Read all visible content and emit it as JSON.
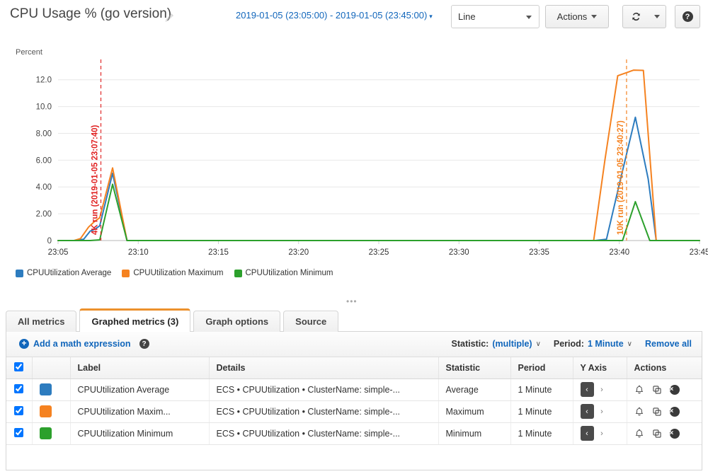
{
  "header": {
    "title": "CPU Usage % (go version)",
    "edit_icon": "pencil-icon",
    "time_range": "2019-01-05 (23:05:00) - 2019-01-05 (23:45:00)",
    "range_caret": "▾",
    "graph_type": "Line",
    "actions_label": "Actions",
    "refresh_icon": "refresh-icon",
    "help_icon": "help-icon",
    "help_glyph": "?"
  },
  "chart_data": {
    "type": "line",
    "title": "CPU Usage % (go version)",
    "ylabel": "Percent",
    "xlabel": "",
    "ylim": [
      0,
      13.2
    ],
    "yticks": [
      "0",
      "2.00",
      "4.00",
      "6.00",
      "8.00",
      "10.0",
      "12.0"
    ],
    "ytick_values": [
      0,
      2,
      4,
      6,
      8,
      10,
      12
    ],
    "xticks": [
      "23:05",
      "23:10",
      "23:15",
      "23:20",
      "23:25",
      "23:30",
      "23:35",
      "23:40",
      "23:45"
    ],
    "xtick_minutes": [
      0,
      5,
      10,
      15,
      20,
      25,
      30,
      35,
      40
    ],
    "grid": true,
    "legend_position": "bottom-left",
    "x_unit": "minutes from 23:05",
    "series": [
      {
        "name": "CPUUtilization Average",
        "color": "#2d7cbf",
        "points": [
          [
            0,
            0
          ],
          [
            1.0,
            0
          ],
          [
            1.6,
            0.1
          ],
          [
            2.0,
            0.7
          ],
          [
            2.3,
            0.85
          ],
          [
            2.6,
            1.1
          ],
          [
            3.4,
            5.02
          ],
          [
            4.3,
            0
          ],
          [
            5.0,
            0
          ],
          [
            33.5,
            0
          ],
          [
            34.2,
            0.1
          ],
          [
            35.0,
            4.2
          ],
          [
            36.0,
            9.2
          ],
          [
            36.8,
            4.6
          ],
          [
            37.3,
            0
          ],
          [
            40,
            0
          ]
        ]
      },
      {
        "name": "CPUUtilization Maximum",
        "color": "#f58220",
        "points": [
          [
            0,
            0
          ],
          [
            1.0,
            0
          ],
          [
            1.4,
            0.15
          ],
          [
            1.9,
            1.0
          ],
          [
            2.3,
            1.45
          ],
          [
            2.6,
            1.7
          ],
          [
            3.4,
            5.42
          ],
          [
            4.3,
            0
          ],
          [
            5.0,
            0
          ],
          [
            33.4,
            0
          ],
          [
            34.1,
            6.0
          ],
          [
            34.9,
            12.3
          ],
          [
            35.9,
            12.72
          ],
          [
            36.5,
            12.7
          ],
          [
            37.3,
            0
          ],
          [
            40,
            0
          ]
        ]
      },
      {
        "name": "CPUUtilization Minimum",
        "color": "#2ca02c",
        "points": [
          [
            0,
            0
          ],
          [
            2.0,
            0
          ],
          [
            2.6,
            0.05
          ],
          [
            3.4,
            4.2
          ],
          [
            4.3,
            0
          ],
          [
            5.0,
            0
          ],
          [
            35.2,
            0
          ],
          [
            36.0,
            2.9
          ],
          [
            36.9,
            0
          ],
          [
            40,
            0
          ]
        ]
      }
    ],
    "annotations": [
      {
        "label": "4K run (2019-01-05 23:07:40)",
        "x_minutes": 2.67,
        "color": "#e02020",
        "style": "dashed-vertical"
      },
      {
        "label": "10K run (2019-01-05 23:40:27)",
        "x_minutes": 35.45,
        "color": "#f58220",
        "style": "dashed-vertical"
      }
    ],
    "legend": [
      {
        "label": "CPUUtilization Average",
        "color": "#2d7cbf"
      },
      {
        "label": "CPUUtilization Maximum",
        "color": "#f58220"
      },
      {
        "label": "CPUUtilization Minimum",
        "color": "#2ca02c"
      }
    ]
  },
  "drag_handle": "•••",
  "tabs": [
    {
      "label": "All metrics",
      "active": false
    },
    {
      "label": "Graphed metrics (3)",
      "active": true
    },
    {
      "label": "Graph options",
      "active": false
    },
    {
      "label": "Source",
      "active": false
    }
  ],
  "toolbar": {
    "add_math_expression": "Add a math expression",
    "plus_glyph": "+",
    "help_glyph": "?",
    "statistic_label": "Statistic:",
    "statistic_value": "(multiple)",
    "period_label": "Period:",
    "period_value": "1 Minute",
    "chevron": "∨",
    "remove_all": "Remove all"
  },
  "table": {
    "header_checkbox_checked": true,
    "columns": [
      "",
      "",
      "Label",
      "Details",
      "Statistic",
      "Period",
      "Y Axis",
      "Actions"
    ],
    "rows": [
      {
        "checked": true,
        "color": "#2d7cbf",
        "label": "CPUUtilization Average",
        "details": "ECS • CPUUtilization • ClusterName: simple-...",
        "statistic": "Average",
        "period": "1 Minute",
        "yaxis_left": "‹",
        "yaxis_right": "›",
        "yaxis_selected": "left",
        "actions": [
          "alarm-bell-icon",
          "duplicate-icon",
          "remove-icon"
        ]
      },
      {
        "checked": true,
        "color": "#f58220",
        "label": "CPUUtilization Maxim...",
        "details": "ECS • CPUUtilization • ClusterName: simple-...",
        "statistic": "Maximum",
        "period": "1 Minute",
        "yaxis_left": "‹",
        "yaxis_right": "›",
        "yaxis_selected": "left",
        "actions": [
          "alarm-bell-icon",
          "duplicate-icon",
          "remove-icon"
        ]
      },
      {
        "checked": true,
        "color": "#2ca02c",
        "label": "CPUUtilization Minimum",
        "details": "ECS • CPUUtilization • ClusterName: simple-...",
        "statistic": "Minimum",
        "period": "1 Minute",
        "yaxis_left": "‹",
        "yaxis_right": "›",
        "yaxis_selected": "left",
        "actions": [
          "alarm-bell-icon",
          "duplicate-icon",
          "remove-icon"
        ]
      }
    ]
  },
  "colors": {
    "accent_blue": "#1166bb",
    "tab_active_orange": "#ec912d",
    "series_average": "#2d7cbf",
    "series_maximum": "#f58220",
    "series_minimum": "#2ca02c",
    "annotation_red": "#e02020"
  }
}
